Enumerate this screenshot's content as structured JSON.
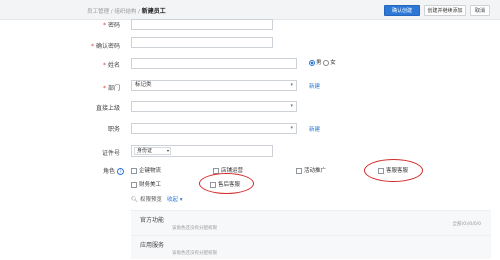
{
  "breadcrumb": {
    "parent": "员工管理 / 组织结构 / ",
    "current": "新建员工"
  },
  "header_buttons": {
    "confirm": "确认创建",
    "create_continue": "创建并继续添加",
    "cancel": "取消"
  },
  "form": {
    "password": {
      "label": "密码",
      "value": ""
    },
    "confirm_password": {
      "label": "确认密码",
      "value": ""
    },
    "name": {
      "label": "姓名",
      "value": ""
    },
    "gender": {
      "male": "男",
      "female": "女",
      "selected": "男"
    },
    "department": {
      "label": "部门",
      "value": "标记类",
      "add_link": "新建"
    },
    "supervisor": {
      "label": "直接上级",
      "value": ""
    },
    "position": {
      "label": "职务",
      "value": "",
      "add_link": "新建"
    },
    "id_number": {
      "label": "证件号",
      "type": "身份证",
      "value": ""
    },
    "roles": {
      "label": "角色",
      "options": [
        "企键物流",
        "店铺运营",
        "活动推广",
        "客服客服",
        "财务美工",
        "售后客服"
      ]
    }
  },
  "permissions": {
    "preview_label": "权限预览",
    "expand_label": "收起",
    "rows": [
      {
        "name": "官方功能",
        "desc": "该角色还没有分配权限",
        "right": "全部(0)/0/0/0"
      },
      {
        "name": "应用服务",
        "desc": "该角色还没有分配权限",
        "right": ""
      }
    ]
  },
  "colors": {
    "primary": "#2d78d6",
    "required": "#e23b3b",
    "highlight_ellipse": "#d32a2a"
  }
}
